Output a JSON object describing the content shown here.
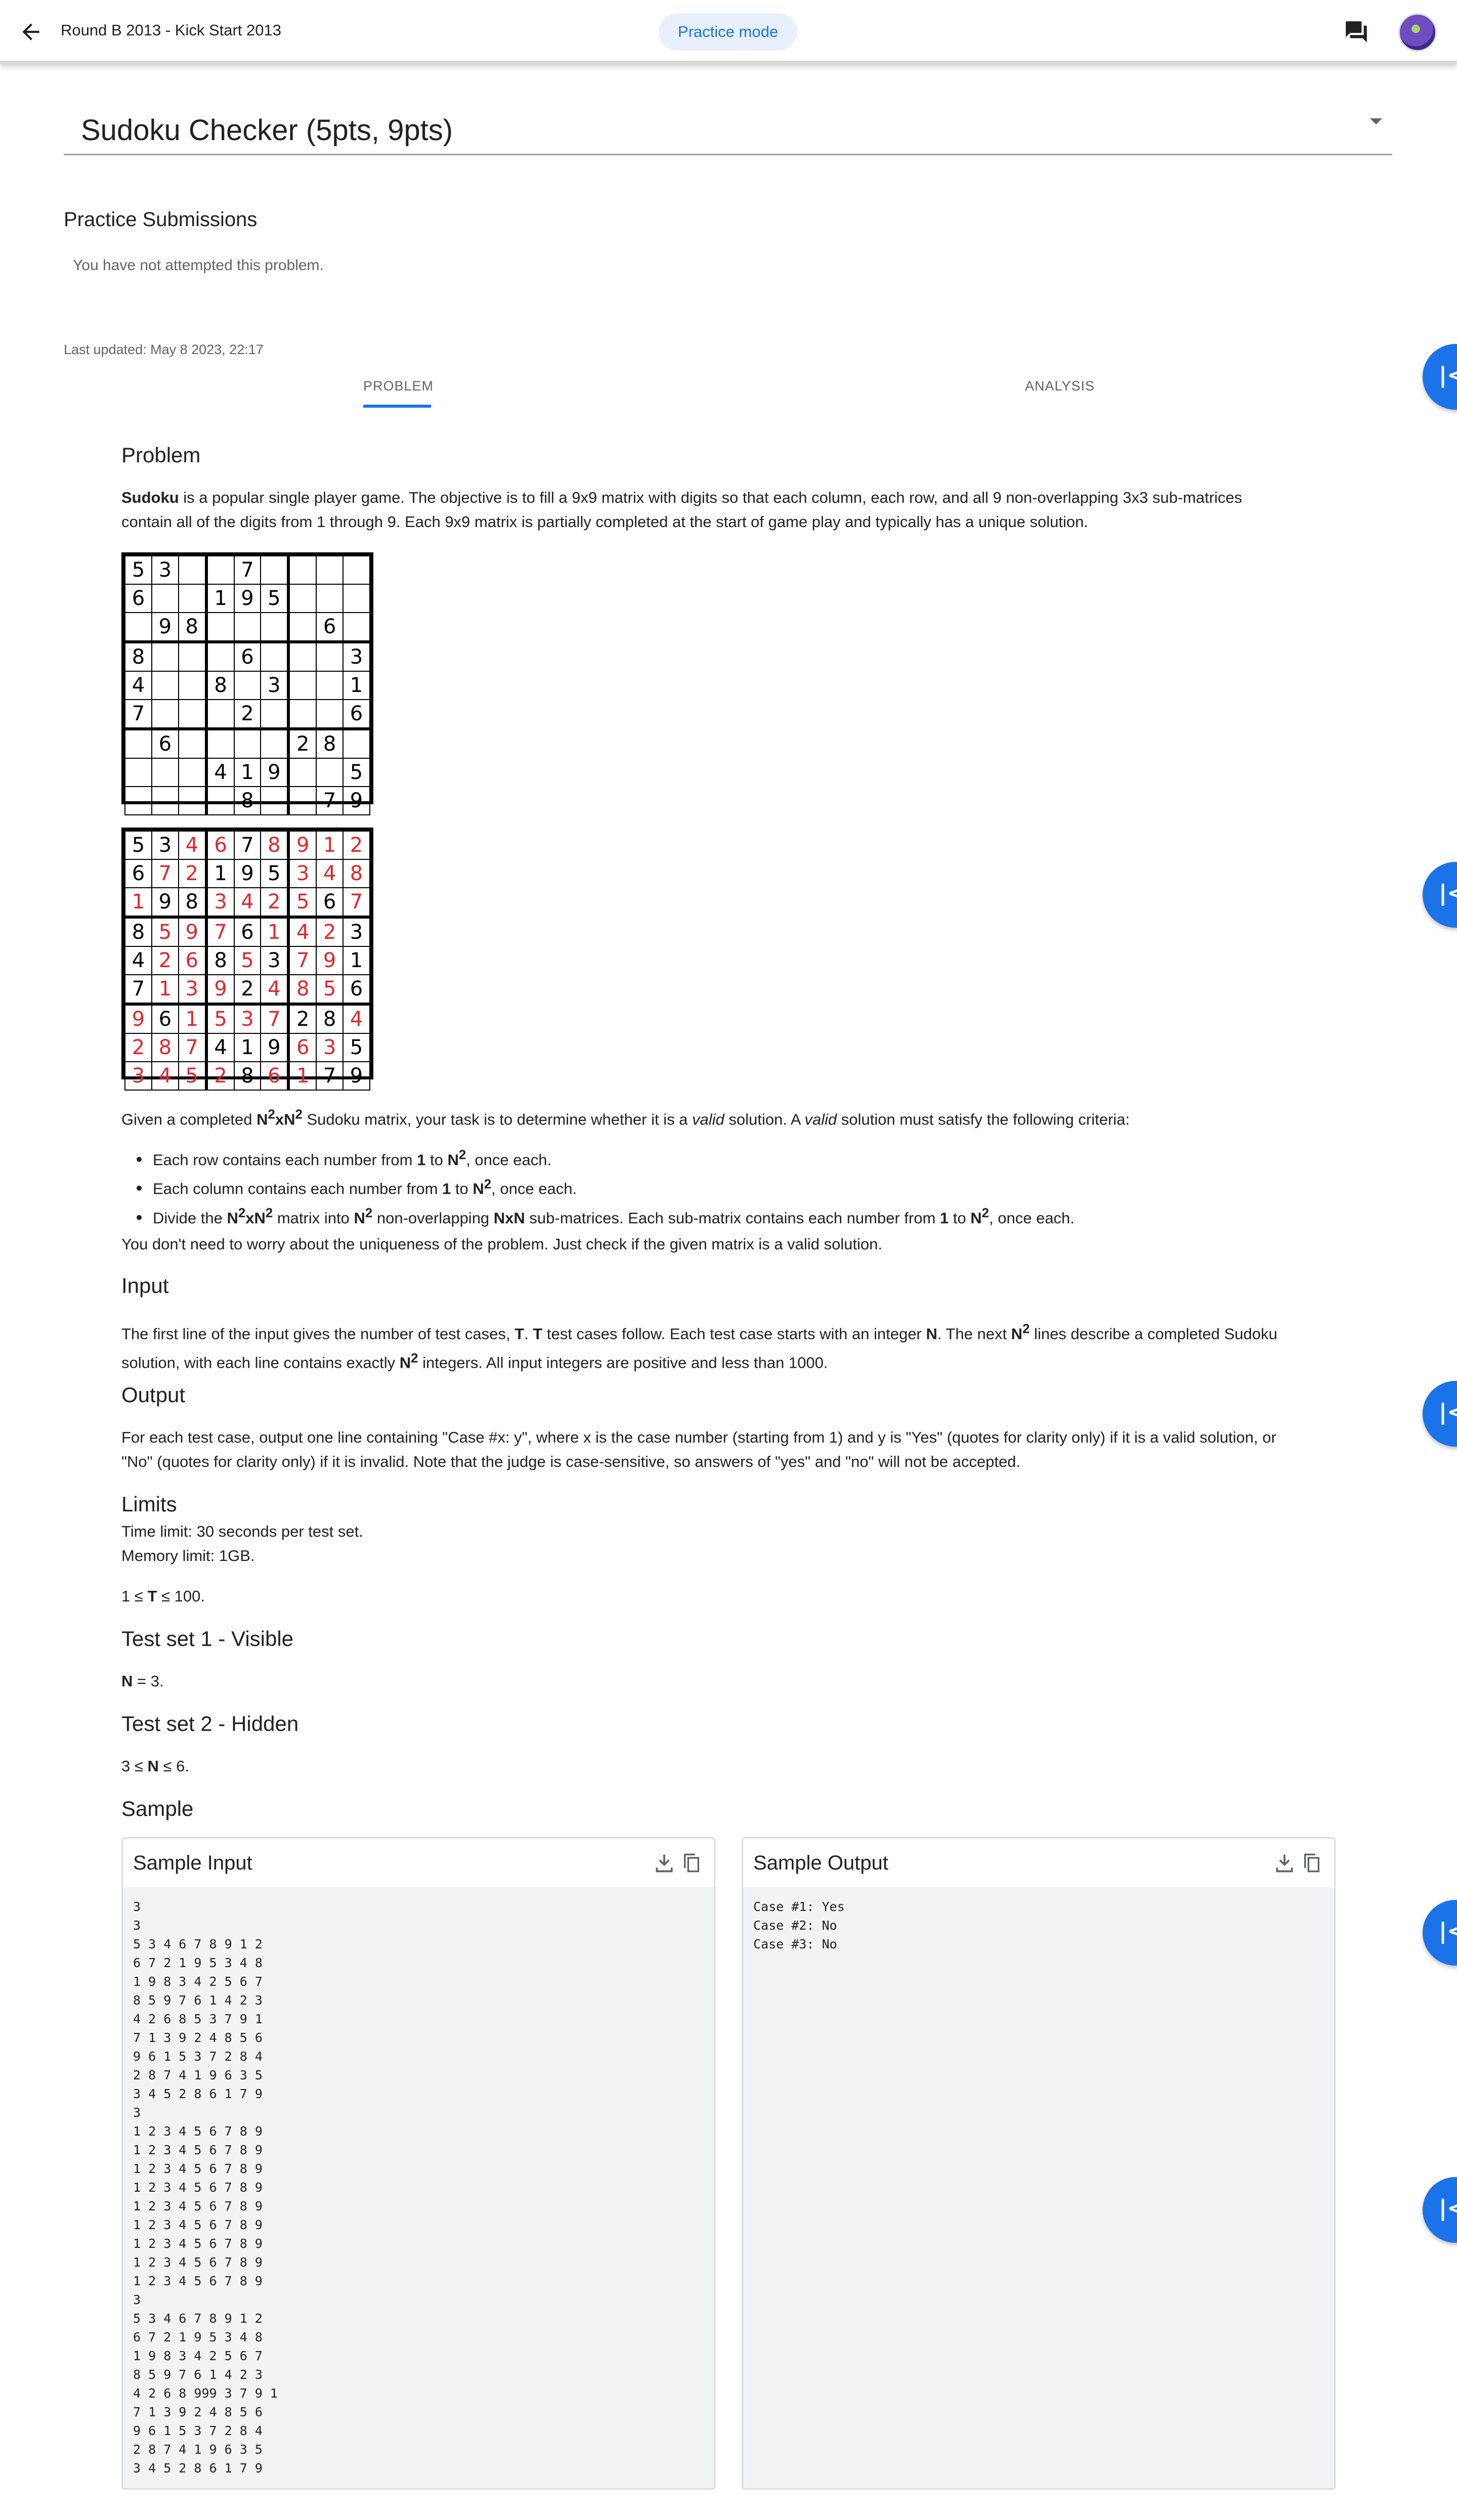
{
  "header": {
    "breadcrumb": "Round B 2013 - Kick Start 2013",
    "mode_chip": "Practice mode"
  },
  "problem_select": {
    "title": "Sudoku Checker (5pts, 9pts)"
  },
  "submissions": {
    "heading": "Practice Submissions",
    "empty_text": "You have not attempted this problem."
  },
  "last_updated": "Last updated: May 8 2023, 22:17",
  "tabs": [
    {
      "label": "PROBLEM"
    },
    {
      "label": "ANALYSIS"
    }
  ],
  "statement": {
    "problem_heading": "Problem",
    "intro_bold": "Sudoku",
    "intro_line1": " is a popular single player game. The objective is to fill a 9x9 matrix with digits so that each column, each row, and all 9 non-overlapping 3x3 sub-matrices",
    "intro_line2": "contain all of the digits from 1 through 9. Each 9x9 matrix is partially completed at the start of game play and typically has a unique solution.",
    "puzzle_grid": [
      "53  7    ",
      "6  195   ",
      " 98    6 ",
      "8   6   3",
      "4  8 3  1",
      "7   2   6",
      " 6    28 ",
      "   419  5",
      "    8  79"
    ],
    "solution_grid": [
      "534678912",
      "672195348",
      "198342567",
      "859761423",
      "426853791",
      "713924856",
      "961537284",
      "287419635",
      "345286179"
    ],
    "given_text": {
      "a": "Given a completed ",
      "b": "N",
      "c": "2",
      "d": "xN",
      "e": "2",
      "f": " Sudoku matrix, your task is to determine whether it is a ",
      "g": "valid",
      "h": " solution. A ",
      "i": "valid",
      "j": " solution must satisfy the following criteria:"
    },
    "criteria": [
      {
        "pre": "Each row contains each number from ",
        "one": "1",
        "to": " to ",
        "n": "N",
        "sq": "2",
        "post": ", once each."
      },
      {
        "pre": "Each column contains each number from ",
        "one": "1",
        "to": " to ",
        "n": "N",
        "sq": "2",
        "post": ", once each."
      },
      {
        "pre": "Divide the ",
        "m": "N",
        "msq": "2",
        "mx": "xN",
        "msq2": "2",
        "mid": " matrix into ",
        "mn": "N",
        "mnsq": "2",
        "mid2": " non-overlapping ",
        "nxn": "NxN",
        "mid3": " sub-matrices. Each sub-matrix contains each number from ",
        "one": "1",
        "to": " to ",
        "n": "N",
        "sq": "2",
        "post": ", once each."
      }
    ],
    "uniqueness_note": "You don't need to worry about the uniqueness of the problem. Just check if the given matrix is a valid solution.",
    "input_heading": "Input",
    "input_text": {
      "a": "The first line of the input gives the number of test cases, ",
      "b": "T",
      "c": ". ",
      "d": "T",
      "e": " test cases follow. Each test case starts with an integer ",
      "f": "N",
      "g": ". The next ",
      "h": "N",
      "i": "2",
      "j": " lines describe a completed Sudoku",
      "k": "solution, with each line contains exactly ",
      "l": "N",
      "m": "2",
      "n": " integers. All input integers are positive and less than 1000."
    },
    "output_heading": "Output",
    "output_line1": "For each test case, output one line containing \"Case #x: y\", where x is the case number (starting from 1) and y is \"Yes\" (quotes for clarity only) if it is a valid solution, or",
    "output_line2": "\"No\" (quotes for clarity only) if it is invalid. Note that the judge is case-sensitive, so answers of \"yes\" and \"no\" will not be accepted.",
    "limits_heading": "Limits",
    "time_limit": "Time limit: 30 seconds per test set.",
    "memory_limit": "Memory limit: 1GB.",
    "t_range": {
      "a": "1 ≤ ",
      "b": "T",
      "c": " ≤ 100."
    },
    "test_set_1": {
      "heading": "Test set 1 - Visible",
      "a": "N",
      "b": " = 3."
    },
    "test_set_2": {
      "heading": "Test set 2 - Hidden",
      "a": "3 ≤ ",
      "b": "N",
      "c": " ≤ 6."
    },
    "sample_heading": "Sample"
  },
  "sample_input": {
    "title": "Sample Input",
    "text": "3\n3\n5 3 4 6 7 8 9 1 2\n6 7 2 1 9 5 3 4 8\n1 9 8 3 4 2 5 6 7\n8 5 9 7 6 1 4 2 3\n4 2 6 8 5 3 7 9 1\n7 1 3 9 2 4 8 5 6\n9 6 1 5 3 7 2 8 4\n2 8 7 4 1 9 6 3 5\n3 4 5 2 8 6 1 7 9\n3\n1 2 3 4 5 6 7 8 9\n1 2 3 4 5 6 7 8 9\n1 2 3 4 5 6 7 8 9\n1 2 3 4 5 6 7 8 9\n1 2 3 4 5 6 7 8 9\n1 2 3 4 5 6 7 8 9\n1 2 3 4 5 6 7 8 9\n1 2 3 4 5 6 7 8 9\n1 2 3 4 5 6 7 8 9\n3\n5 3 4 6 7 8 9 1 2\n6 7 2 1 9 5 3 4 8\n1 9 8 3 4 2 5 6 7\n8 5 9 7 6 1 4 2 3\n4 2 6 8 999 3 7 9 1\n7 1 3 9 2 4 8 5 6\n9 6 1 5 3 7 2 8 4\n2 8 7 4 1 9 6 3 5\n3 4 5 2 8 6 1 7 9"
  },
  "sample_output": {
    "title": "Sample Output",
    "text": "Case #1: Yes\nCase #2: No\nCase #3: No"
  },
  "colors": {
    "accent": "#1a73e8",
    "chip_bg": "#e8f0fe",
    "red_digit": "#e3262b"
  },
  "icons": [
    "back-arrow-icon",
    "chat-icon",
    "avatar",
    "dropdown-icon",
    "collapse-panel-icon",
    "download-icon",
    "copy-icon"
  ]
}
